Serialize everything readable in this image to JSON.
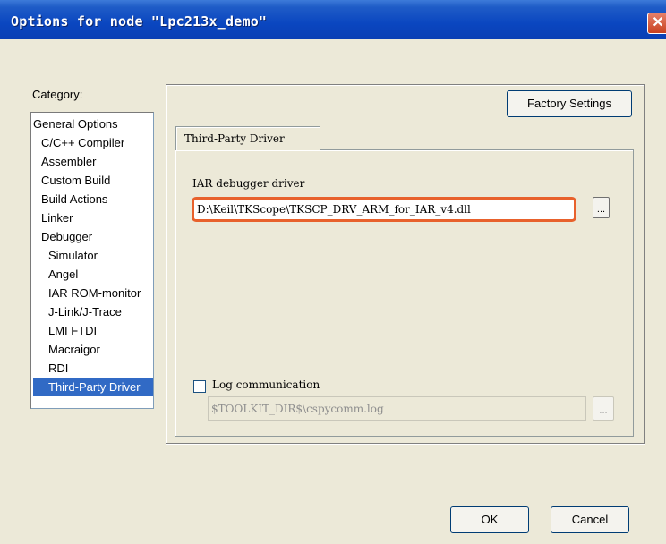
{
  "window": {
    "title": "Options for node \"Lpc213x_demo\"",
    "close_glyph": "✕"
  },
  "category": {
    "label": "Category:",
    "items": [
      {
        "label": "General Options"
      },
      {
        "label": "C/C++ Compiler"
      },
      {
        "label": "Assembler"
      },
      {
        "label": "Custom Build"
      },
      {
        "label": "Build Actions"
      },
      {
        "label": "Linker"
      },
      {
        "label": "Debugger"
      },
      {
        "label": "Simulator"
      },
      {
        "label": "Angel"
      },
      {
        "label": "IAR ROM-monitor"
      },
      {
        "label": "J-Link/J-Trace"
      },
      {
        "label": "LMI FTDI"
      },
      {
        "label": "Macraigor"
      },
      {
        "label": "RDI"
      },
      {
        "label": "Third-Party Driver"
      }
    ],
    "selected": "Third-Party Driver"
  },
  "panel": {
    "factory_settings": "Factory Settings",
    "tab_label": "Third-Party Driver",
    "driver_label": "IAR debugger driver",
    "driver_value": "D:\\Keil\\TKScope\\TKSCP_DRV_ARM_for_IAR_v4.dll",
    "browse_glyph": "...",
    "log_checked": false,
    "log_label": "Log communication",
    "log_path": "$TOOLKIT_DIR$\\cspycomm.log"
  },
  "buttons": {
    "ok": "OK",
    "cancel": "Cancel"
  },
  "colors": {
    "title_bar": "#0a46c0",
    "selection": "#316ac5",
    "highlight_border": "#e8612c",
    "dialog_bg": "#ece9d8"
  }
}
